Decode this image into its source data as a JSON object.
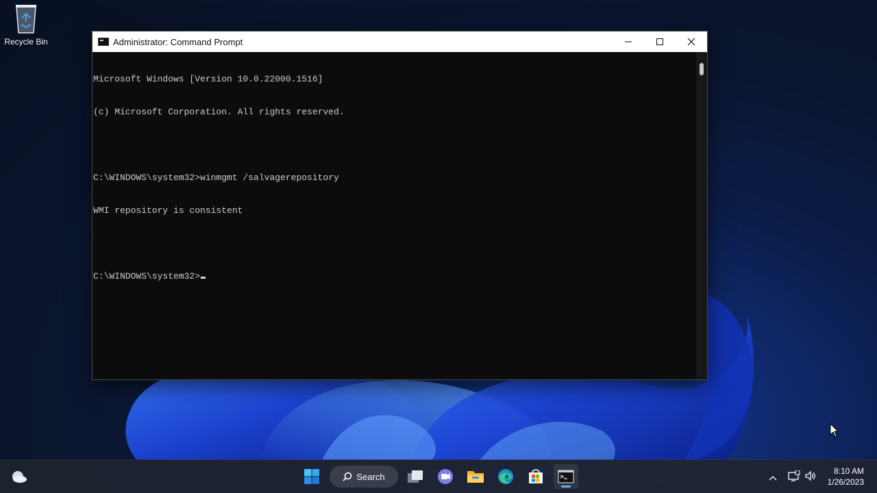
{
  "desktop": {
    "recycle_bin_label": "Recycle Bin"
  },
  "window": {
    "title": "Administrator: Command Prompt",
    "console_lines": [
      "Microsoft Windows [Version 10.0.22000.1516]",
      "(c) Microsoft Corporation. All rights reserved.",
      "",
      "C:\\WINDOWS\\system32>winmgmt /salvagerepository",
      "WMI repository is consistent",
      "",
      "C:\\WINDOWS\\system32>"
    ]
  },
  "taskbar": {
    "search_label": "Search",
    "apps": [
      "start-icon",
      "task-view-icon",
      "teams-chat-icon",
      "file-explorer-icon",
      "edge-icon",
      "store-icon",
      "terminal-icon"
    ],
    "active_app": "terminal-icon"
  },
  "tray": {
    "time": "8:10 AM",
    "date": "1/26/2023"
  },
  "colors": {
    "console_bg": "#0c0c0c",
    "console_text": "#cccccc",
    "accent": "#5fb2f2"
  }
}
